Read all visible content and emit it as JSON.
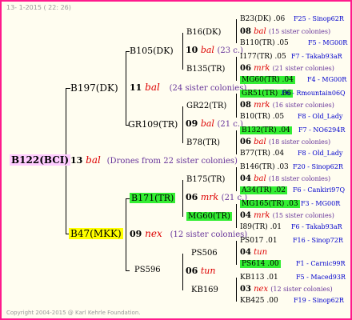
{
  "header": "13-  1-2015 ( 22: 26)",
  "footer": "Copyright 2004-2015 @ Karl Kehrle Foundation.",
  "root": {
    "name": "B122(BCI)",
    "gen": "13",
    "race": "bal",
    "note": "(Drones from 22 sister colonies)"
  },
  "father": {
    "name": "B197(DK)",
    "gen": "11",
    "race": "bal",
    "note": "(24 sister colonies)"
  },
  "mother": {
    "name": "B47(MKK)",
    "gen": "09",
    "race": "nex",
    "note": "(12 sister colonies)"
  },
  "ff": {
    "name": "B105(DK)",
    "gen": "10",
    "race": "bal",
    "note": "(23 c.)"
  },
  "fm": {
    "name": "GR109(TR)",
    "gen": "09",
    "race": "bal",
    "note": "(21 c.)"
  },
  "mf": {
    "name": "B171(TR)",
    "gen": "06",
    "race": "mrk",
    "note": "(21 c.)"
  },
  "mm": {
    "name": "PS596",
    "gen": "06",
    "race": "tun"
  },
  "g4": [
    {
      "name": "B16(DK)",
      "gen": "08",
      "race": "bal",
      "note": "(15 sister colonies)",
      "top": "B23(DK) .06",
      "top_right": "F25 - Sinop62R",
      "bottom": "B110(TR) .05",
      "bottom_right": "F5 - MG00R"
    },
    {
      "name": "B135(TR)",
      "gen": "06",
      "race": "mrk",
      "note": "(21 sister colonies)",
      "top": "I177(TR) .05",
      "top_right": "F7 - Takab93aR",
      "bottom": "MG60(TR) .04",
      "bottom_right": "F4 - MG00R"
    },
    {
      "name": "GR22(TR)",
      "gen": "08",
      "race": "mrk",
      "note": "(16 sister colonies)",
      "top": "GR51(TR) .06",
      "top_right": "F6 - Rmountain06Q",
      "bottom": "B10(TR) .05",
      "bottom_right": "F8 - Old_Lady"
    },
    {
      "name": "B78(TR)",
      "gen": "06",
      "race": "bal",
      "note": "(18 sister colonies)",
      "top": "B132(TR) .04",
      "top_right": "F7 - NO6294R",
      "bottom": "B77(TR) .04",
      "bottom_right": "F8 - Old_Lady"
    },
    {
      "name": "B175(TR)",
      "gen": "04",
      "race": "bal",
      "note": "(18 sister colonies)",
      "top": "B146(TR) .03",
      "top_right": "F20 - Sinop62R",
      "bottom": "A34(TR) .02",
      "bottom_right": "F6 - Cankiri97Q"
    },
    {
      "name": "MG60(TR)",
      "gen": "04",
      "race": "mrk",
      "note": "(15 sister colonies)",
      "top": "MG165(TR) .03",
      "top_right": "F3 - MG00R",
      "bottom": "I89(TR) .01",
      "bottom_right": "F6 - Takab93aR"
    },
    {
      "name": "PS506",
      "gen": "04",
      "race": "tun",
      "note": "",
      "top": "PS017 .01",
      "top_right": "F16 - Sinop72R",
      "bottom": "PS614 .00",
      "bottom_right": "F1 - Carnic99R"
    },
    {
      "name": "KB169",
      "gen": "03",
      "race": "nex",
      "note": "(12 sister colonies)",
      "top": "KB113 .01",
      "top_right": "F5 - Maced93R",
      "bottom": "KB425 .00",
      "bottom_right": "F19 - Sinop62R"
    }
  ],
  "colors": {
    "frame": "#ff1a8c",
    "race": "#dd0000",
    "note": "#663399",
    "origin": "#0000cc",
    "highlight_pink": "#ffccff",
    "highlight_green": "#33ee33",
    "highlight_yellow": "#ffff00"
  }
}
